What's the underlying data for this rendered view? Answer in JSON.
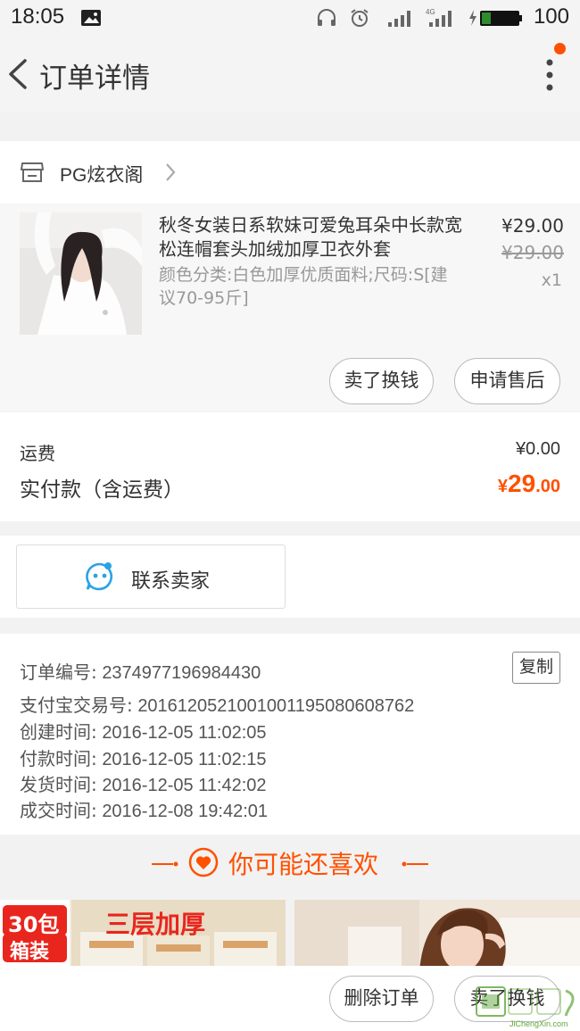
{
  "status_bar": {
    "time": "18:05",
    "battery": "100"
  },
  "nav": {
    "title": "订单详情"
  },
  "shop": {
    "name": "PG炫衣阁"
  },
  "item": {
    "title": "秋冬女装日系软妹可爱兔耳朵中长款宽松连帽套头加绒加厚卫衣外套",
    "sku": "颜色分类:白色加厚优质面料;尺码:S[建议70-95斤]",
    "price": "¥29.00",
    "original_price": "¥29.00",
    "quantity": "x1",
    "buttons": {
      "sell": "卖了换钱",
      "after_sale": "申请售后"
    }
  },
  "fees": {
    "shipping_label": "运费",
    "shipping_value": "¥0.00",
    "paid_label": "实付款（含运费）",
    "paid_currency": "¥",
    "paid_integer": "29",
    "paid_decimal": ".00"
  },
  "contact": {
    "label": "联系卖家"
  },
  "order_info": {
    "copy_label": "复制",
    "lines": [
      {
        "label": "订单编号:",
        "value": "2374977196984430"
      },
      {
        "label": "支付宝交易号:",
        "value": "2016120521001001195080608762"
      },
      {
        "label": "创建时间:",
        "value": "2016-12-05 11:02:05"
      },
      {
        "label": "付款时间:",
        "value": "2016-12-05 11:02:15"
      },
      {
        "label": "发货时间:",
        "value": "2016-12-05 11:42:02"
      },
      {
        "label": "成交时间:",
        "value": "2016-12-08 19:42:01"
      }
    ]
  },
  "recommend": {
    "title": "你可能还喜欢",
    "products": [
      {
        "badge_line1": "30包",
        "badge_line2": "箱装",
        "banner": "三层加厚"
      }
    ]
  },
  "bottom": {
    "delete_label": "删除订单",
    "sell_label": "卖了换钱"
  },
  "watermark": {
    "text": "JiChengXin.com"
  },
  "colors": {
    "accent": "#ff5000",
    "blue": "#2aa2e6",
    "text": "#333333",
    "muted": "#999999"
  }
}
